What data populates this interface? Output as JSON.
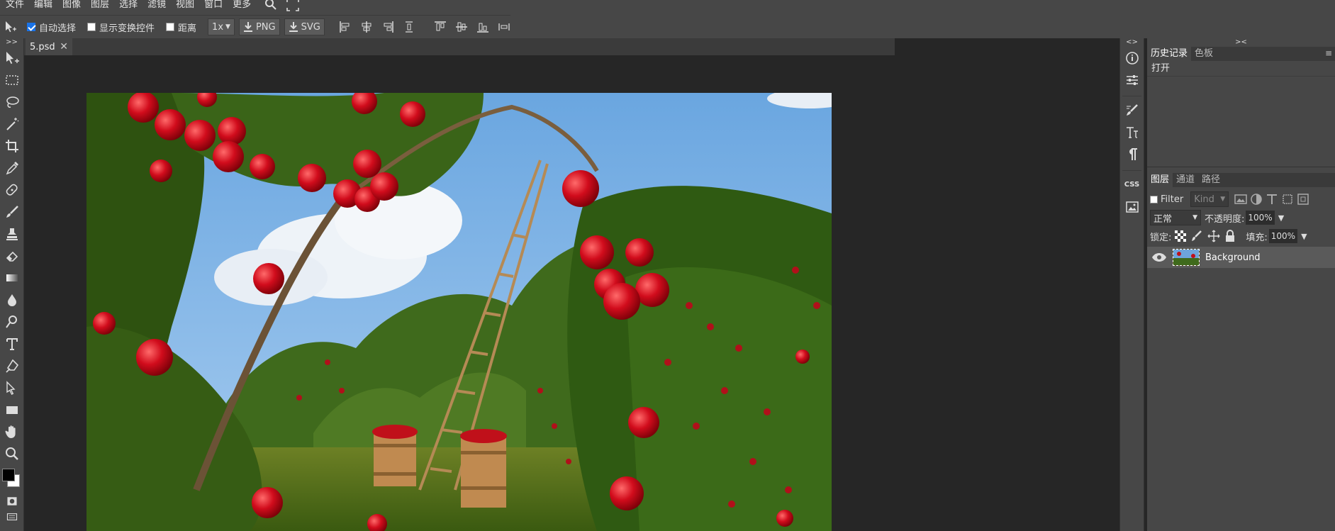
{
  "menubar": {
    "items": [
      "文件",
      "编辑",
      "图像",
      "图层",
      "选择",
      "滤镜",
      "视图",
      "窗口",
      "更多"
    ]
  },
  "options": {
    "auto_select": "自动选择",
    "show_transform": "显示变换控件",
    "distance": "距离",
    "zoom_select": "1x",
    "png_label": "PNG",
    "svg_label": "SVG"
  },
  "toolbar_header": ">>",
  "tab": {
    "name": "5.psd",
    "close": "✕"
  },
  "rstrip_header": "<>",
  "rstrip_css": "CSS",
  "panels": {
    "header": "><",
    "history_tab": "历史记录",
    "swatches_tab": "色板",
    "history_item": "打开",
    "layers_tab": "图层",
    "channels_tab": "通道",
    "paths_tab": "路径",
    "filter_label": "Filter",
    "kind_label": "Kind",
    "blend_mode": "正常",
    "opacity_label": "不透明度:",
    "opacity_value": "100%",
    "lock_label": "锁定:",
    "fill_label": "填充:",
    "fill_value": "100%",
    "layer_name": "Background"
  },
  "colors": {
    "foreground": "#000000",
    "background": "#ffffff"
  }
}
